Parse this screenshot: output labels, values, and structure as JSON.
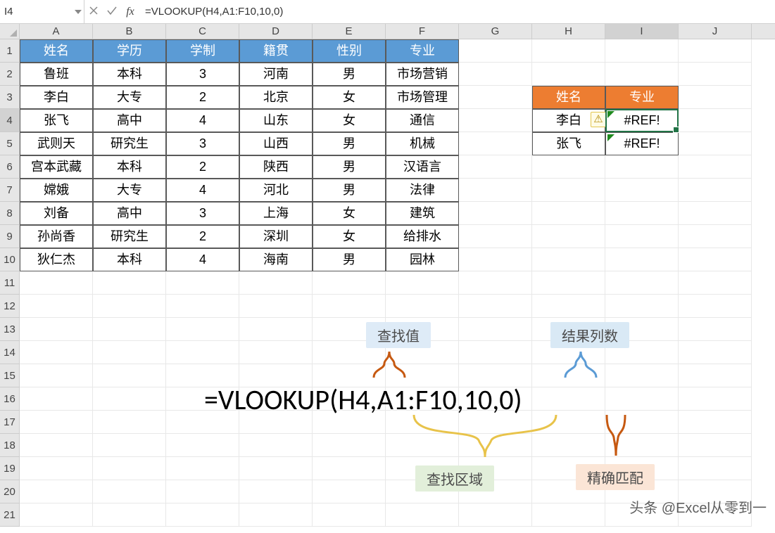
{
  "namebox": "I4",
  "formula_bar": "=VLOOKUP(H4,A1:F10,10,0)",
  "columns": [
    "A",
    "B",
    "C",
    "D",
    "E",
    "F",
    "G",
    "H",
    "I",
    "J"
  ],
  "active_col": "I",
  "active_row": 4,
  "main_table": {
    "headers": [
      "姓名",
      "学历",
      "学制",
      "籍贯",
      "性别",
      "专业"
    ],
    "rows": [
      [
        "鲁班",
        "本科",
        "3",
        "河南",
        "男",
        "市场营销"
      ],
      [
        "李白",
        "大专",
        "2",
        "北京",
        "女",
        "市场管理"
      ],
      [
        "张飞",
        "高中",
        "4",
        "山东",
        "女",
        "通信"
      ],
      [
        "武则天",
        "研究生",
        "3",
        "山西",
        "男",
        "机械"
      ],
      [
        "宫本武藏",
        "本科",
        "2",
        "陕西",
        "男",
        "汉语言"
      ],
      [
        "嫦娥",
        "大专",
        "4",
        "河北",
        "男",
        "法律"
      ],
      [
        "刘备",
        "高中",
        "3",
        "上海",
        "女",
        "建筑"
      ],
      [
        "孙尚香",
        "研究生",
        "2",
        "深圳",
        "女",
        "给排水"
      ],
      [
        "狄仁杰",
        "本科",
        "4",
        "海南",
        "男",
        "园林"
      ]
    ]
  },
  "lookup_table": {
    "headers": [
      "姓名",
      "专业"
    ],
    "rows": [
      [
        "李白",
        "#REF!"
      ],
      [
        "张飞",
        "#REF!"
      ]
    ]
  },
  "big_formula": "=VLOOKUP(H4,A1:F10,10,0)",
  "callouts": {
    "lookup_value": "查找值",
    "result_col": "结果列数",
    "lookup_range": "查找区域",
    "exact_match": "精确匹配"
  },
  "watermark": "头条 @Excel从零到一",
  "warn_glyph": "⚠"
}
